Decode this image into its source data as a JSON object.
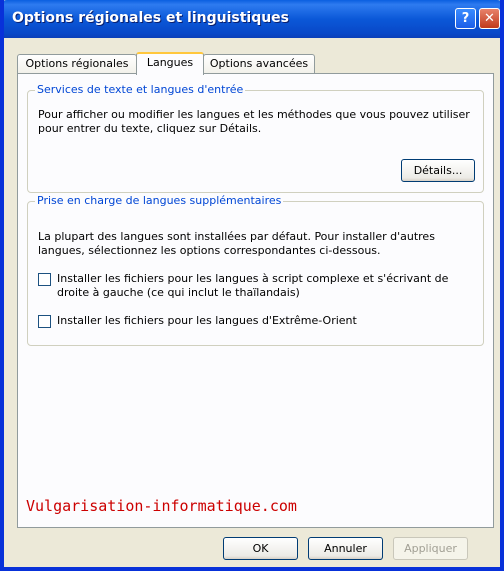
{
  "window": {
    "title": "Options régionales et linguistiques",
    "help_glyph": "?",
    "close_glyph": "✕"
  },
  "tabs": [
    {
      "label": "Options régionales",
      "active": false
    },
    {
      "label": "Langues",
      "active": true
    },
    {
      "label": "Options avancées",
      "active": false
    }
  ],
  "group1": {
    "title": "Services de texte et langues d'entrée",
    "description_line1": "Pour afficher ou modifier les langues et les méthodes que vous pouvez utiliser",
    "description_line2": "pour entrer du texte, cliquez sur Détails.",
    "details_button": "Détails..."
  },
  "group2": {
    "title": "Prise en charge de langues supplémentaires",
    "description_line1": "La plupart des langues sont installées par défaut. Pour installer d'autres",
    "description_line2": "langues, sélectionnez les options correspondantes ci-dessous.",
    "checkbox1_line1": "Installer les fichiers pour les langues à script complexe et s'écrivant de",
    "checkbox1_line2": "droite à gauche (ce qui inclut le thaïlandais)",
    "checkbox1_checked": false,
    "checkbox2_label": "Installer les fichiers pour les langues d'Extrême-Orient",
    "checkbox2_checked": false
  },
  "watermark": "Vulgarisation-informatique.com",
  "footer": {
    "ok": "OK",
    "cancel": "Annuler",
    "apply": "Appliquer"
  }
}
